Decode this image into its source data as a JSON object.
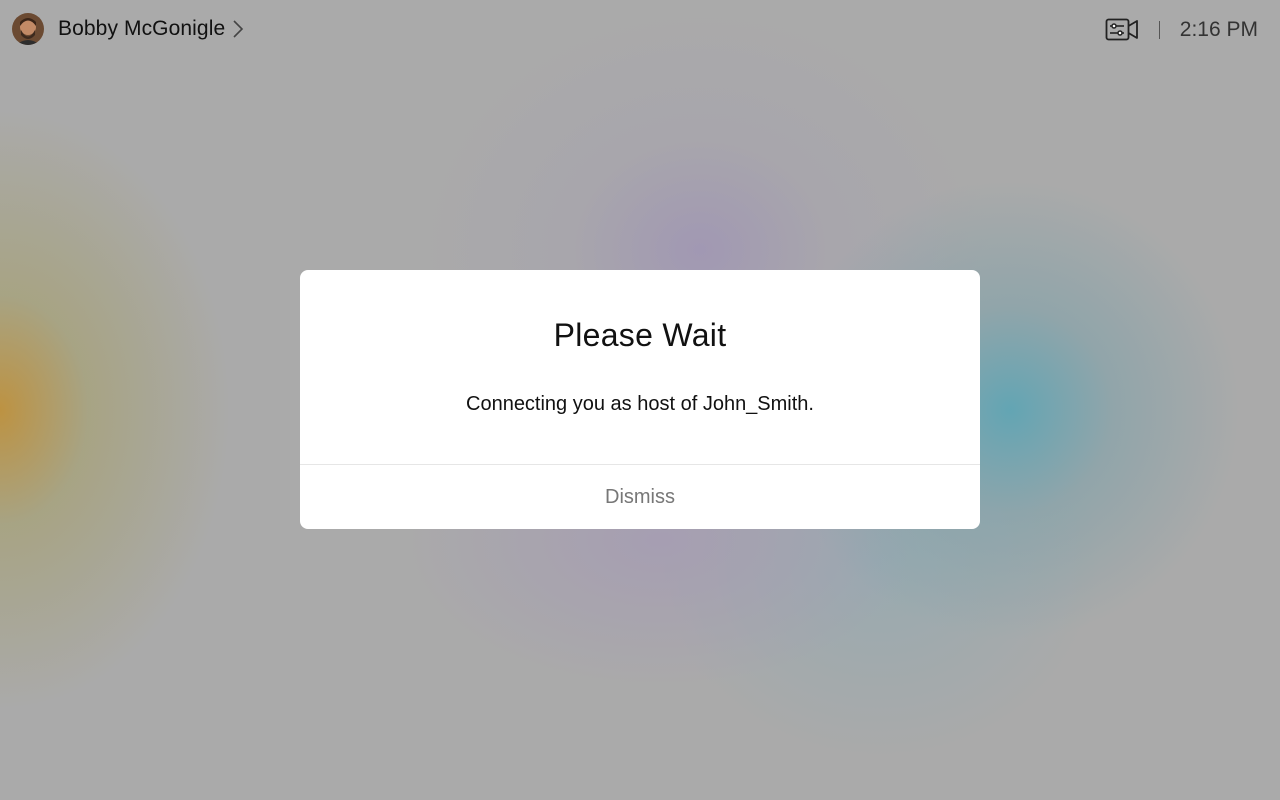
{
  "header": {
    "user_name": "Bobby McGonigle",
    "time": "2:16 PM",
    "camera_icon": "camera-controls-icon",
    "chevron_icon": "chevron-right-icon"
  },
  "dialog": {
    "title": "Please Wait",
    "message": "Connecting you as host of John_Smith.",
    "dismiss_label": "Dismiss"
  }
}
